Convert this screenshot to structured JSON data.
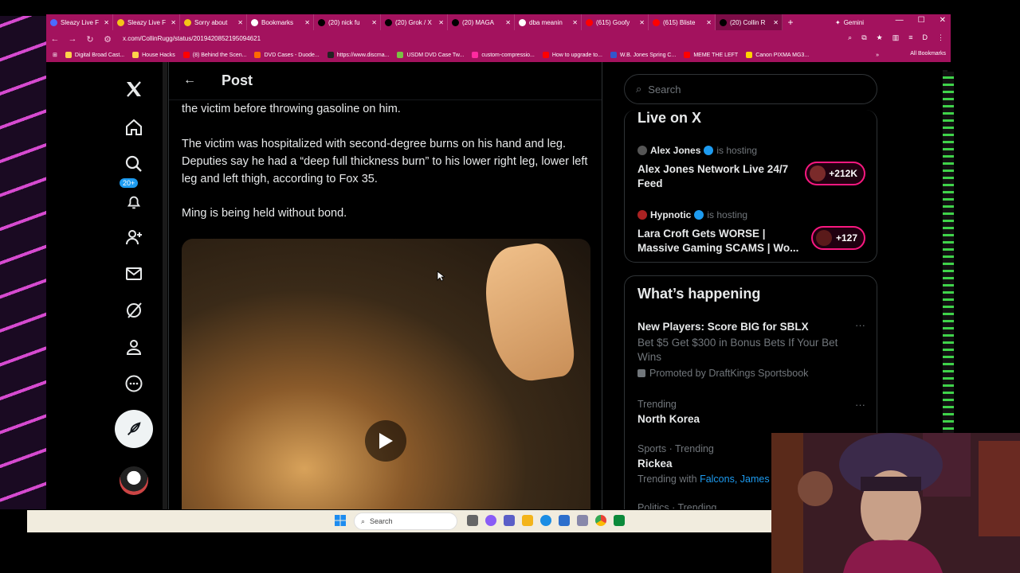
{
  "browser": {
    "tabs": [
      {
        "label": "Sleazy Live F",
        "fav_color": "#4b6bff",
        "active": false
      },
      {
        "label": "Sleazy Live F",
        "fav_color": "#f5c518",
        "active": false
      },
      {
        "label": "Sorry about",
        "fav_color": "#f5c518",
        "active": false
      },
      {
        "label": "Bookmarks",
        "fav_color": "#ffffff",
        "active": false
      },
      {
        "label": "(20) nick fu",
        "fav_color": "#000000",
        "active": false
      },
      {
        "label": "(20) Grok / X",
        "fav_color": "#000000",
        "active": false
      },
      {
        "label": "(20) MAGA",
        "fav_color": "#000000",
        "active": false
      },
      {
        "label": "dba meanin",
        "fav_color": "#ffffff",
        "active": false
      },
      {
        "label": "(615) Goofy",
        "fav_color": "#ff0000",
        "active": false
      },
      {
        "label": "(615) Bliste",
        "fav_color": "#ff0000",
        "active": false
      },
      {
        "label": "(20) Collin R",
        "fav_color": "#000000",
        "active": true
      }
    ],
    "new_tab": "+",
    "gemini_label": "Gemini",
    "url": "x.com/CollinRugg/status/2019420852195094621",
    "profile_initial": "D",
    "bookmarks": [
      {
        "label": "Digital Broad Cast...",
        "color": "#ffd24a"
      },
      {
        "label": "House Hacks",
        "color": "#ffd24a"
      },
      {
        "label": "(8) Behind the Scen...",
        "color": "#ff0000"
      },
      {
        "label": "DVD Cases - Duode...",
        "color": "#ff6a00"
      },
      {
        "label": "https://www.discma...",
        "color": "#222222"
      },
      {
        "label": "USDM DVD Case Tw...",
        "color": "#7ac143"
      },
      {
        "label": "custom-compressio...",
        "color": "#ff2aa0"
      },
      {
        "label": "How to upgrade to...",
        "color": "#ff0000"
      },
      {
        "label": "W.B. Jones Spring C...",
        "color": "#3355cc"
      },
      {
        "label": "MEME THE LEFT",
        "color": "#ff0000"
      },
      {
        "label": "Canon PIXMA MG3...",
        "color": "#ffd200"
      }
    ],
    "more_bookmarks": "»",
    "all_bookmarks": "All Bookmarks"
  },
  "sidebar": {
    "notifications_badge": "20+"
  },
  "post": {
    "header_title": "Post",
    "paragraphs": [
      "the victim before throwing gasoline on him.",
      "The victim was hospitalized with second-degree burns on his hand and leg. Deputies say he had a “deep full thickness burn” to his lower right leg, lower left leg and left thigh, according to Fox 35.",
      "Ming is being held without bond."
    ]
  },
  "right_column": {
    "search_placeholder": "Search",
    "live_title": "Live on X",
    "live_items": [
      {
        "host": "Alex Jones",
        "hosting": "is hosting",
        "title": "Alex Jones Network Live 24/7 Feed",
        "count": "+212K"
      },
      {
        "host": "Hypnotic",
        "hosting": "is hosting",
        "title": "Lara Croft Gets WORSE | Massive Gaming SCAMS | Wo...",
        "count": "+127"
      }
    ],
    "happening_title": "What’s happening",
    "promo": {
      "title": "New Players: Score BIG for SBLX",
      "desc": "Bet $5 Get $300 in Bonus Bets If Your Bet Wins",
      "promoted": "Promoted by DraftKings Sportsbook"
    },
    "trends": [
      {
        "context": "Trending",
        "name": "North Korea"
      },
      {
        "context": "Sports · Trending",
        "name": "Rickea",
        "with_label": "Trending with",
        "with_links": "Falcons, James P"
      },
      {
        "context": "Politics · Trending",
        "name": ""
      }
    ]
  },
  "taskbar": {
    "search_label": "Search"
  },
  "colors": {
    "browser_chrome": "#a3125e",
    "x_accent": "#1d9bf0",
    "live_border": "#f91880"
  }
}
